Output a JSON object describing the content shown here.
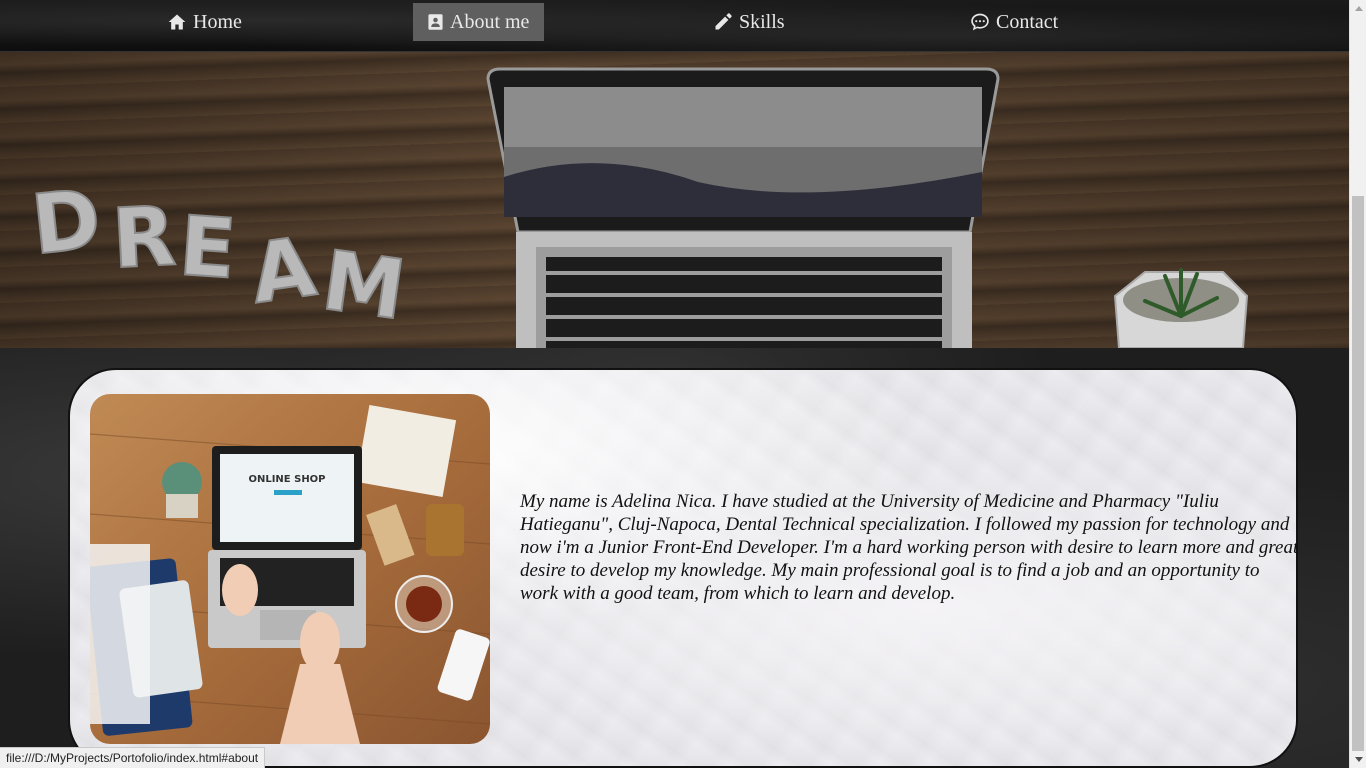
{
  "nav": {
    "items": [
      {
        "label": "Home",
        "icon": "home-icon",
        "active": false
      },
      {
        "label": "About me",
        "icon": "id-card-icon",
        "active": true
      },
      {
        "label": "Skills",
        "icon": "pencil-icon",
        "active": false
      },
      {
        "label": "Contact",
        "icon": "chat-icon",
        "active": false
      }
    ]
  },
  "hero": {
    "dream_text": "DREAM"
  },
  "about": {
    "photo_caption": "ONLINE SHOP",
    "text": "My name is Adelina Nica. I have studied at the University of Medicine and Pharmacy \"Iuliu Hatieganu\", Cluj-Napoca, Dental Technical specialization. I followed my passion for technology and now i'm a Junior Front-End Developer. I'm a hard working person with desire to learn more and great desire to develop my knowledge. My main professional goal is to find a job and an opportunity to work with a good team, from which to learn and develop."
  },
  "status_bar": {
    "url": "file:///D:/MyProjects/Portofolio/index.html#about"
  },
  "colors": {
    "nav_bg": "#141414",
    "nav_active": "#5f5f5f",
    "nav_text": "#e8e8e8",
    "card_bg": "#ecebef",
    "text": "#111111"
  }
}
